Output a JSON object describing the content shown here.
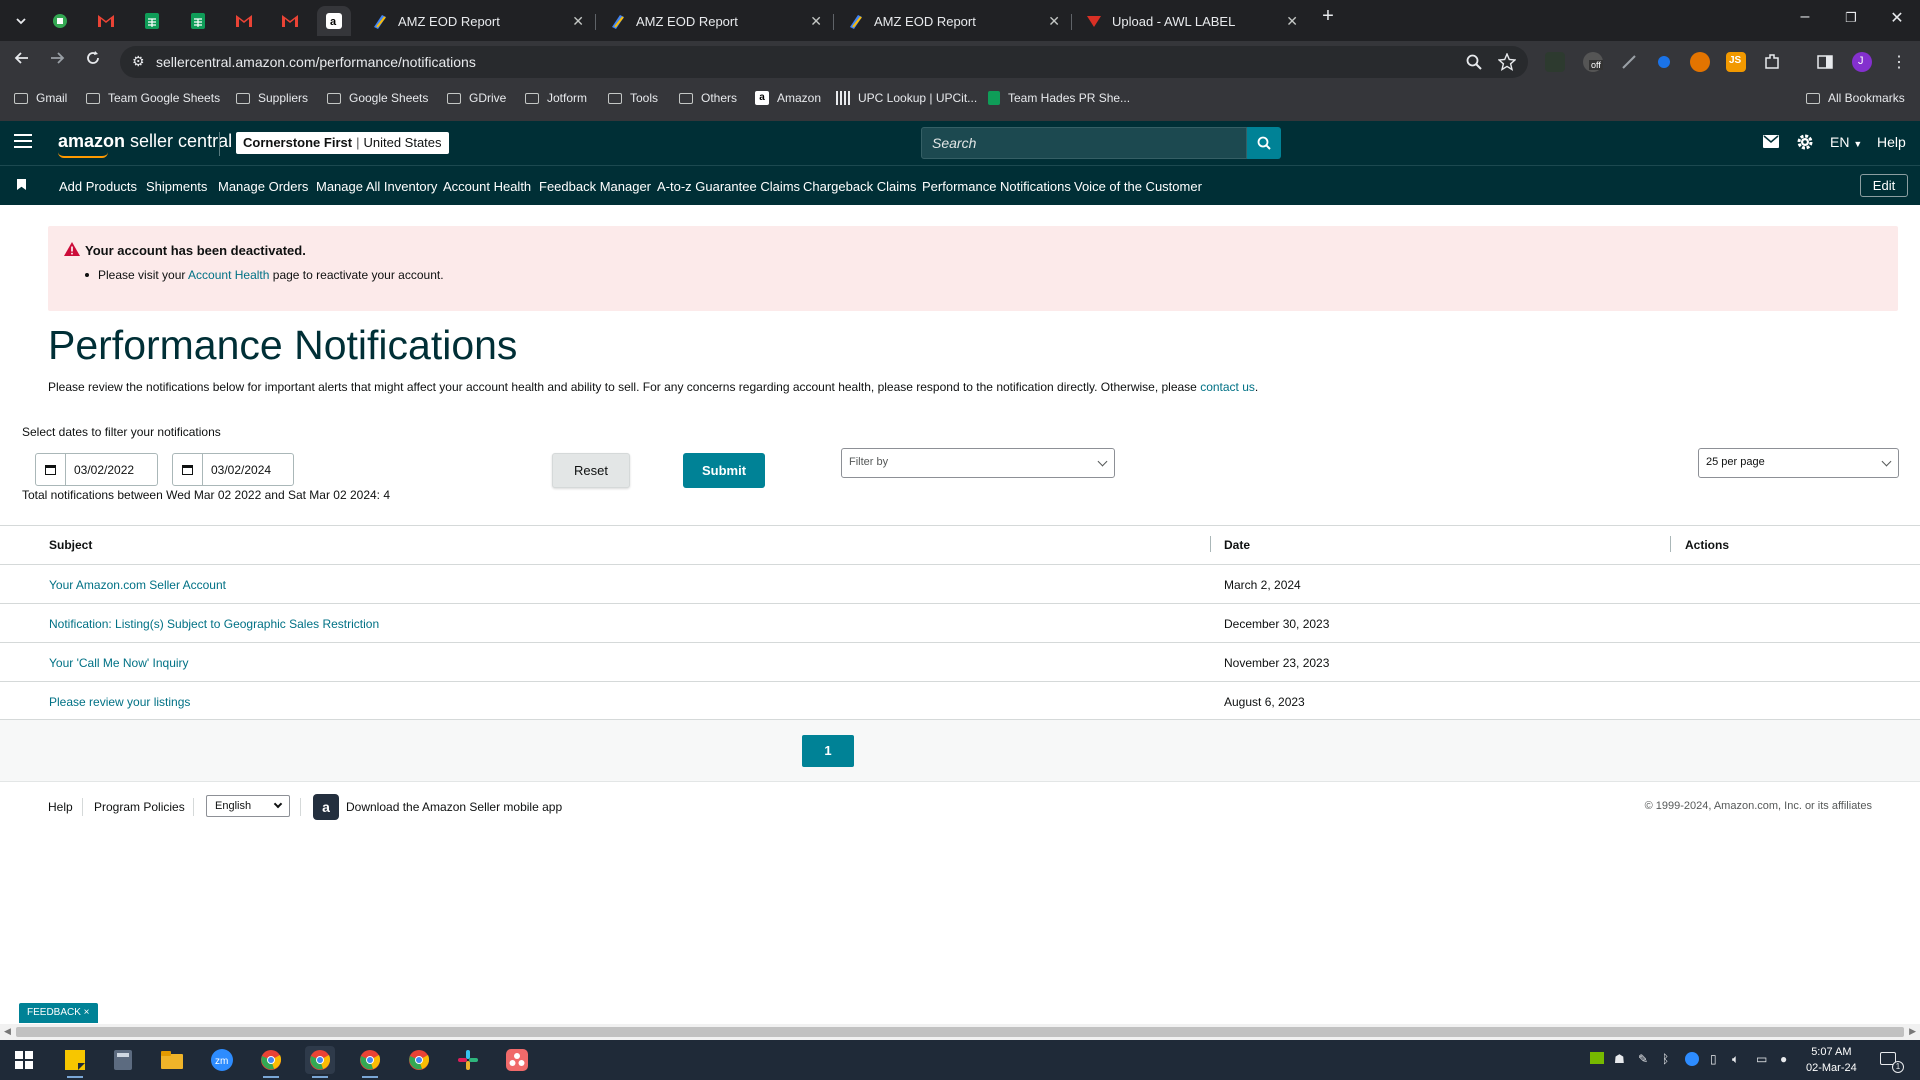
{
  "browser": {
    "tabs": [
      {
        "title": "AMZ EOD Report"
      },
      {
        "title": "AMZ EOD Report"
      },
      {
        "title": "AMZ EOD Report"
      },
      {
        "title": "Upload - AWL LABEL"
      }
    ],
    "url": "sellercentral.amazon.com/performance/notifications",
    "extension_badge": "off",
    "profile_initial": "J",
    "bookmarks": [
      "Gmail",
      "Team Google Sheets",
      "Suppliers",
      "Google Sheets",
      "GDrive",
      "Jotform",
      "Tools",
      "Others",
      "Amazon",
      "UPC Lookup | UPCit...",
      "Team Hades PR She..."
    ],
    "all_bookmarks": "All Bookmarks"
  },
  "header": {
    "logo_bold": "amazon",
    "logo_rest": " seller central",
    "account_name": "Cornerstone First",
    "account_sep": "|",
    "marketplace": "United States",
    "search_placeholder": "Search",
    "language": "EN",
    "help": "Help"
  },
  "nav": {
    "items": [
      "Add Products",
      "Shipments",
      "Manage Orders",
      "Manage All Inventory",
      "Account Health",
      "Feedback Manager",
      "A-to-z Guarantee Claims",
      "Chargeback Claims",
      "Performance Notifications",
      "Voice of the Customer"
    ],
    "edit": "Edit"
  },
  "alert": {
    "title": "Your account has been deactivated.",
    "pre": "Please visit your ",
    "link": "Account Health",
    "post": " page to reactivate your account."
  },
  "page": {
    "title": "Performance Notifications",
    "intro": "Please review the notifications below for important alerts that might affect your account health and ability to sell. For any concerns regarding account health, please respond to the notification directly. Otherwise, please ",
    "intro_link": "contact us",
    "intro_end": ".",
    "filter_label": "Select dates to filter your notifications",
    "date_from": "03/02/2022",
    "date_to": "03/02/2024",
    "reset": "Reset",
    "submit": "Submit",
    "filter_placeholder": "Filter by",
    "per_page": "25 per page",
    "total": "Total notifications between Wed Mar 02 2022 and Sat Mar 02 2024: 4"
  },
  "table": {
    "headers": {
      "subject": "Subject",
      "date": "Date",
      "actions": "Actions"
    },
    "rows": [
      {
        "subject": "Your Amazon.com Seller Account",
        "date": "March 2, 2024"
      },
      {
        "subject": "Notification: Listing(s) Subject to Geographic Sales Restriction",
        "date": "December 30, 2023"
      },
      {
        "subject": "Your 'Call Me Now' Inquiry",
        "date": "November 23, 2023"
      },
      {
        "subject": "Please review your listings",
        "date": "August 6, 2023"
      }
    ]
  },
  "pagination": {
    "current": "1"
  },
  "footer": {
    "help": "Help",
    "policies": "Program Policies",
    "language": "English",
    "app": "Download the Amazon Seller mobile app",
    "copyright": "© 1999-2024, Amazon.com, Inc. or its affiliates"
  },
  "feedback": "FEEDBACK ×",
  "taskbar": {
    "time": "5:07 AM",
    "date": "02-Mar-24",
    "notifications": "1"
  },
  "colors": {
    "header_bg": "#002f36",
    "accent": "#008296",
    "link": "#007185",
    "alert_bg": "#fceaea",
    "alert_icon": "#cc0c39"
  }
}
